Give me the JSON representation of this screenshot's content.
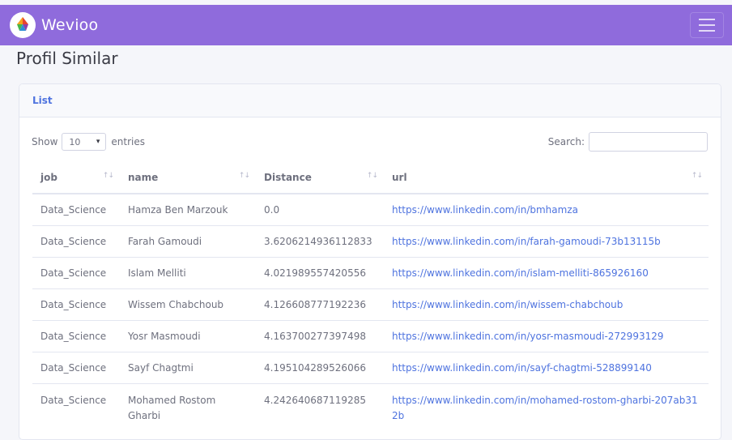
{
  "navbar": {
    "brand": "Wevioo"
  },
  "page": {
    "title": "Profil Similar"
  },
  "card": {
    "header": "List"
  },
  "table_controls": {
    "show_label": "Show",
    "page_size": "10",
    "entries_label": "entries",
    "search_label": "Search:",
    "search_value": ""
  },
  "table": {
    "columns": [
      "job",
      "name",
      "Distance",
      "url"
    ],
    "sort_icons": [
      "↑↓",
      "↑↓",
      "↑↓",
      "↑↓"
    ],
    "rows": [
      {
        "job": "Data_Science",
        "name": "Hamza Ben Marzouk",
        "distance": "0.0",
        "url": "https://www.linkedin.com/in/bmhamza"
      },
      {
        "job": "Data_Science",
        "name": "Farah Gamoudi",
        "distance": "3.6206214936112833",
        "url": "https://www.linkedin.com/in/farah-gamoudi-73b13115b"
      },
      {
        "job": "Data_Science",
        "name": "Islam Melliti",
        "distance": "4.021989557420556",
        "url": "https://www.linkedin.com/in/islam-melliti-865926160"
      },
      {
        "job": "Data_Science",
        "name": "Wissem Chabchoub",
        "distance": "4.126608777192236",
        "url": "https://www.linkedin.com/in/wissem-chabchoub"
      },
      {
        "job": "Data_Science",
        "name": "Yosr Masmoudi",
        "distance": "4.163700277397498",
        "url": "https://www.linkedin.com/in/yosr-masmoudi-272993129"
      },
      {
        "job": "Data_Science",
        "name": "Sayf Chagtmi",
        "distance": "4.195104289526066",
        "url": "https://www.linkedin.com/in/sayf-chagtmi-528899140"
      },
      {
        "job": "Data_Science",
        "name": "Mohamed Rostom Gharbi",
        "distance": "4.242640687119285",
        "url": "https://www.linkedin.com/in/mohamed-rostom-gharbi-207ab312b"
      }
    ]
  },
  "colors": {
    "navbar": "#8f6bdc",
    "link": "#4e73df",
    "card_header_text": "#4e73df"
  }
}
